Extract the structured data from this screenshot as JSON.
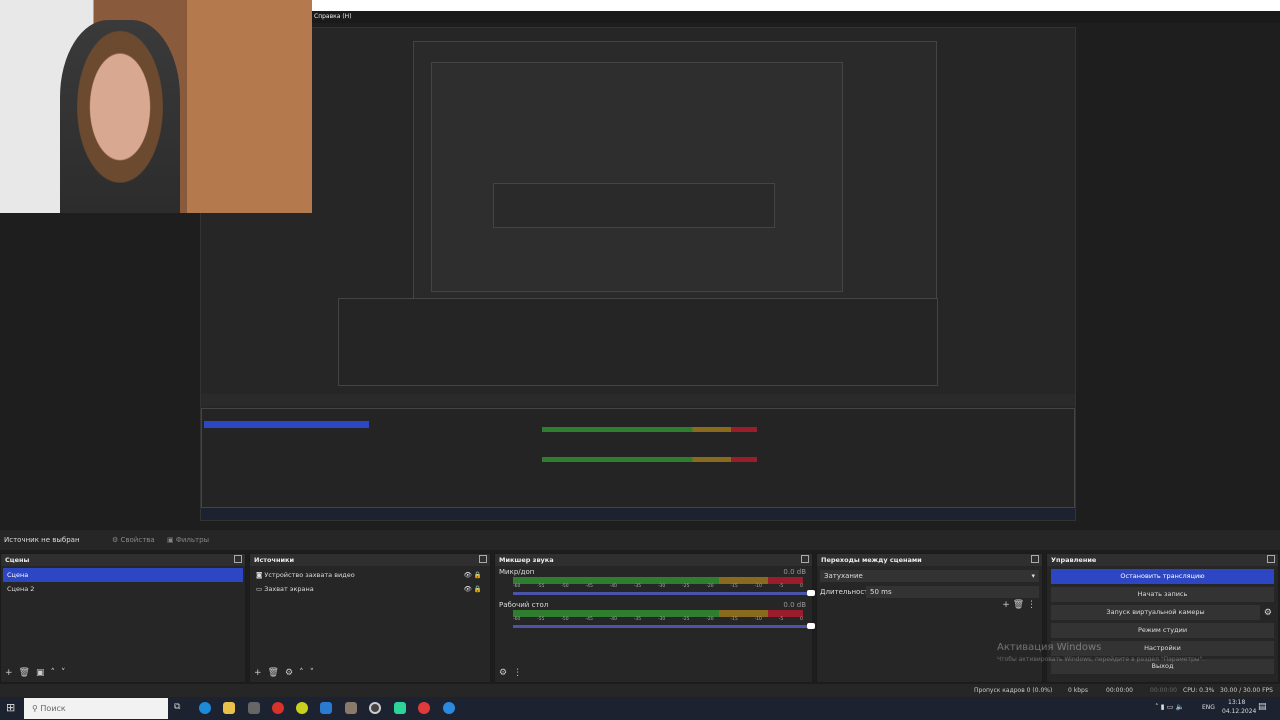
{
  "menu": {
    "help": "Справка (H)"
  },
  "source_toolbar": {
    "status": "Источник не выбран",
    "properties": "Свойства",
    "filters": "Фильтры"
  },
  "scenes": {
    "title": "Сцены",
    "items": [
      {
        "label": "Сцена",
        "selected": true
      },
      {
        "label": "Сцена 2",
        "selected": false
      }
    ]
  },
  "sources": {
    "title": "Источники",
    "items": [
      {
        "label": "Устройство захвата видео",
        "icon": "camera-icon"
      },
      {
        "label": "Захват экрана",
        "icon": "monitor-icon"
      }
    ]
  },
  "mixer": {
    "title": "Микшер звука",
    "tracks": [
      {
        "name": "Микр/доп",
        "db": "0.0 dB",
        "volume": 1.0
      },
      {
        "name": "Рабочий стол",
        "db": "0.0 dB",
        "volume": 1.0
      }
    ],
    "ticks": [
      "-60",
      "-55",
      "-50",
      "-45",
      "-40",
      "-35",
      "-30",
      "-25",
      "-20",
      "-15",
      "-10",
      "-5",
      "0"
    ]
  },
  "transitions": {
    "title": "Переходы между сценами",
    "selected": "Затухание",
    "duration_label": "Длительность",
    "duration": "50 ms"
  },
  "controls": {
    "title": "Управление",
    "buttons": [
      "Остановить трансляцию",
      "Начать запись",
      "Запуск виртуальной камеры",
      "Режим студии",
      "Настройки",
      "Выход"
    ]
  },
  "watermark": {
    "title": "Активация Windows",
    "subtitle": "Чтобы активировать Windows, перейдите в раздел \"Параметры\"."
  },
  "status": {
    "dropped": "Пропуск кадров 0 (0.0%)",
    "bitrate": "0 kbps",
    "stream_time": "00:00:00",
    "rec_time": "00:00:00",
    "cpu": "CPU: 0.3%",
    "fps": "30.00 / 30.00 FPS"
  },
  "taskbar": {
    "search": "Поиск",
    "lang": "ENG",
    "time": "13:18",
    "date": "04.12.2024"
  },
  "colors": {
    "accent": "#2c46c4",
    "dock": "#262626"
  }
}
